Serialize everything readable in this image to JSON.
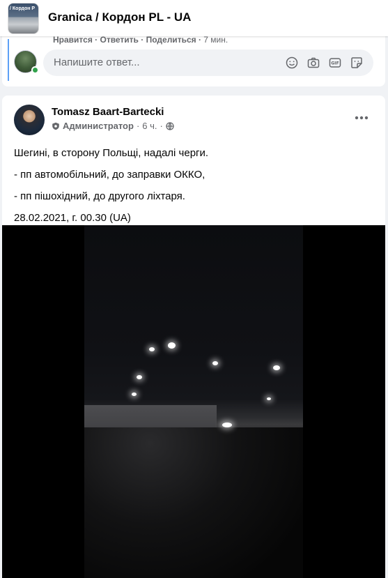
{
  "header": {
    "group_thumb_text": "/ Кордон Р",
    "group_title": "Granica / Кордон PL - UA"
  },
  "comment": {
    "cut_actions": "Нравится · Ответить · Поделиться ·",
    "cut_time": "7 мин.",
    "reply_placeholder": "Напишите ответ...",
    "icons": [
      "emoji-icon",
      "camera-icon",
      "gif-icon",
      "sticker-icon"
    ]
  },
  "post": {
    "author": "Tomasz Baart-Bartecki",
    "role": "Администратор",
    "time": "6 ч.",
    "separator": "·",
    "lines": [
      "Шегині, в сторону Польщі, надалі черги.",
      "- пп автомобільний, до заправки ОККО,",
      "- пп пішохідний, до другого ліхтаря.",
      "28.02.2021, г. 00.30 (UA)"
    ]
  },
  "colors": {
    "accent": "#1877f2",
    "online": "#31a24c",
    "secondary_text": "#65676b"
  }
}
